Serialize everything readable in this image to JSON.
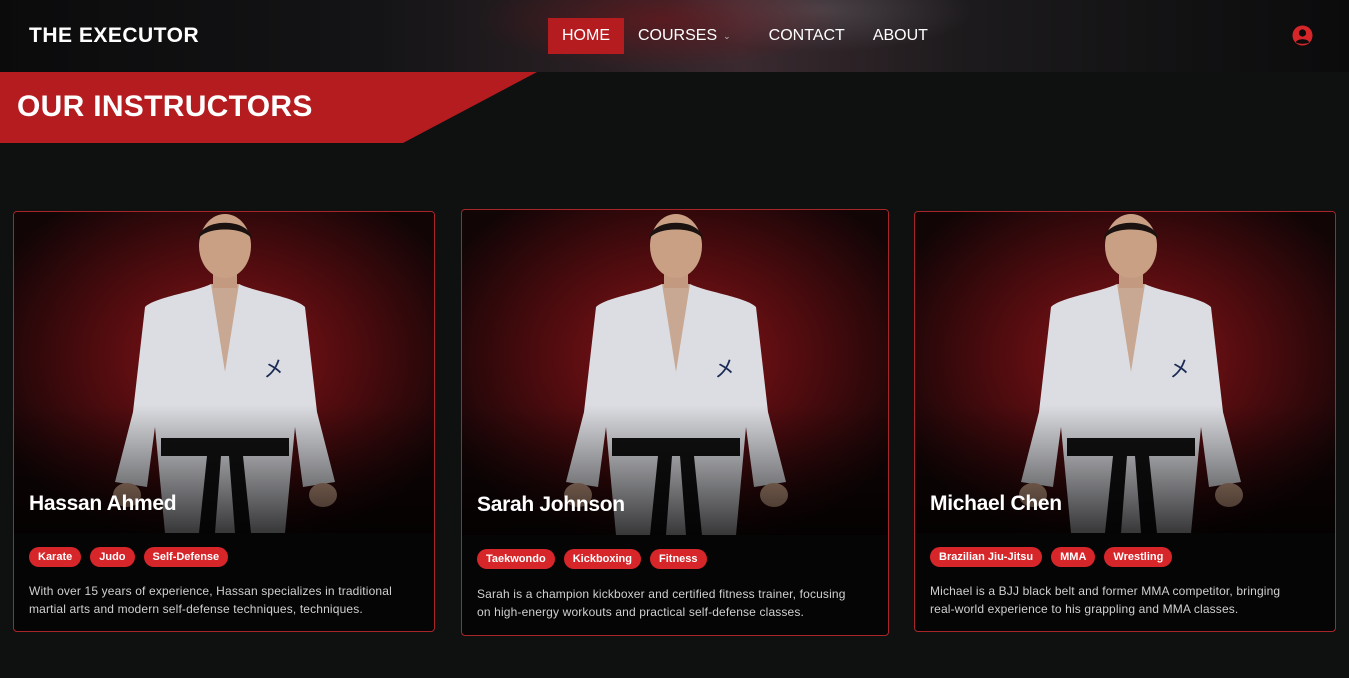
{
  "header": {
    "brand": "THE EXECUTOR",
    "nav": [
      {
        "label": "HOME",
        "active": true
      },
      {
        "label": "COURSES",
        "has_dropdown": true
      },
      {
        "label": "CONTACT"
      },
      {
        "label": "ABOUT"
      }
    ],
    "user_icon": "user-circle-icon"
  },
  "banner": {
    "title": "OUR INSTRUCTORS"
  },
  "instructors": [
    {
      "name": "Hassan Ahmed",
      "tags": [
        "Karate",
        "Judo",
        "Self-Defense"
      ],
      "description_line1": "With over 15 years of experience, Hassan specializes in traditional",
      "description_line2": "martial arts and modern self-defense techniques, techniques."
    },
    {
      "name": "Sarah Johnson",
      "tags": [
        "Taekwondo",
        "Kickboxing",
        "Fitness"
      ],
      "description_line1": "Sarah is a champion kickboxer and certified fitness trainer, focusing",
      "description_line2": "on high-energy workouts and practical self-defense classes."
    },
    {
      "name": "Michael Chen",
      "tags": [
        "Brazilian Jiu-Jitsu",
        "MMA",
        "Wrestling"
      ],
      "description_line1": "Michael is a BJJ black belt and former MMA competitor, bringing",
      "description_line2": "real-world experience to his grappling and MMA classes."
    }
  ],
  "colors": {
    "accent": "#b51c20",
    "tag": "#d7262a",
    "card_border": "#a8262a",
    "background": "#0f1111"
  }
}
